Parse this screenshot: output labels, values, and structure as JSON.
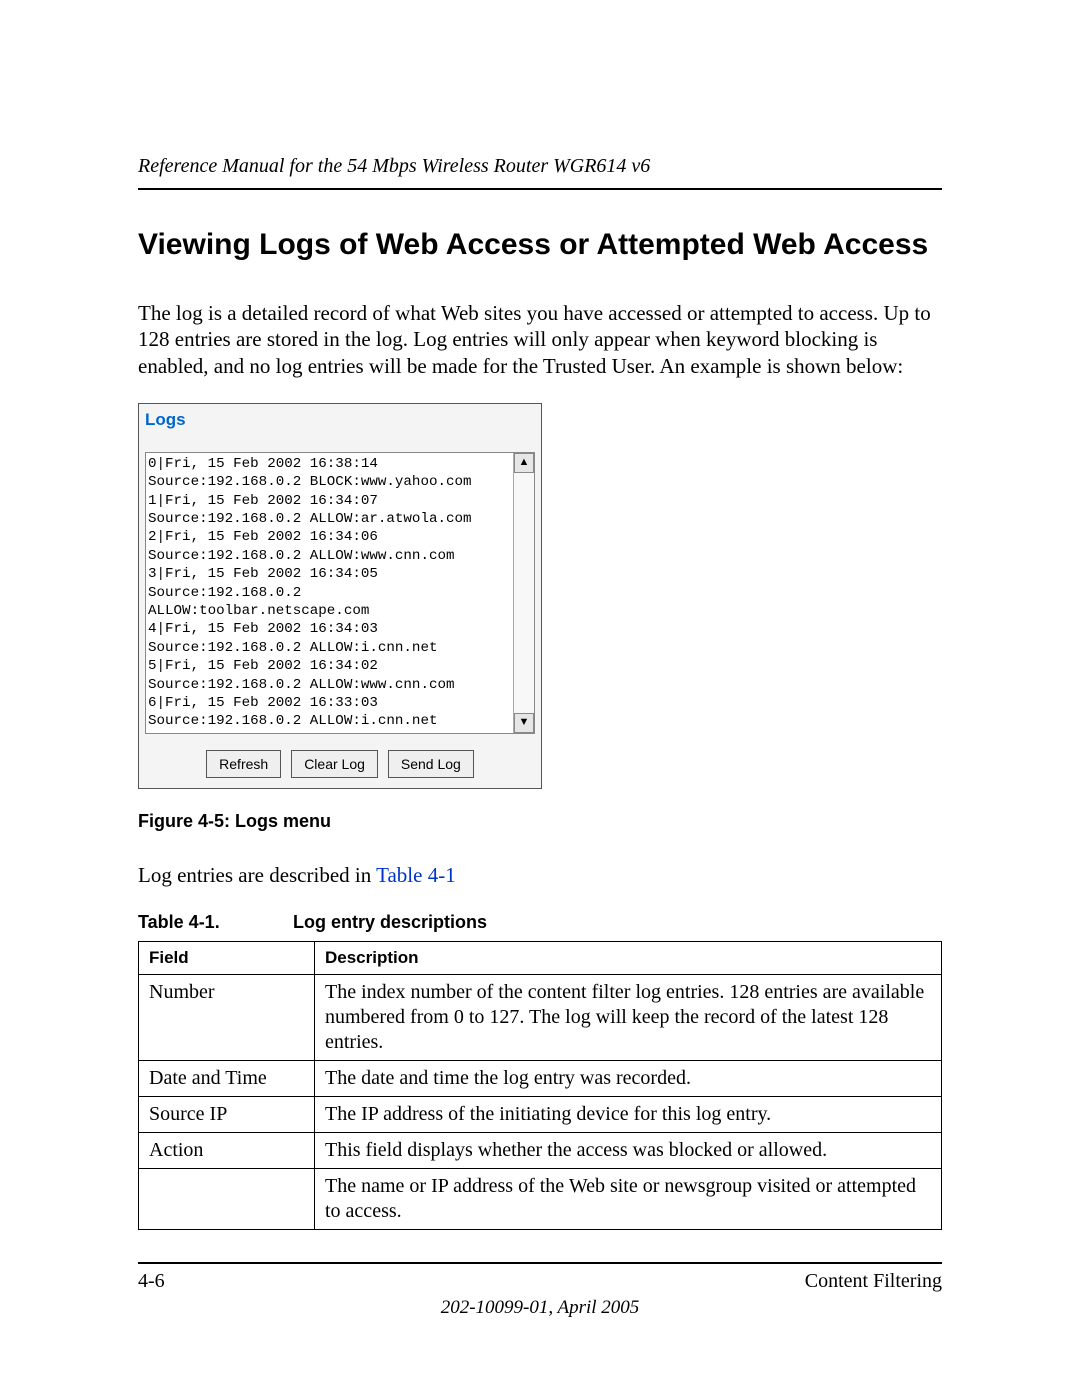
{
  "header": {
    "running_title": "Reference Manual for the 54 Mbps Wireless Router WGR614 v6"
  },
  "section": {
    "title": "Viewing Logs of Web Access or Attempted Web Access",
    "intro": "The log is a detailed record of what Web sites you have accessed or attempted to access. Up to 128 entries are stored in the log. Log entries will only appear when keyword blocking is enabled, and no log entries will be made for the Trusted User. An example is shown below:"
  },
  "logs_panel": {
    "title": "Logs",
    "content": "0|Fri, 15 Feb 2002 16:38:14\nSource:192.168.0.2 BLOCK:www.yahoo.com\n1|Fri, 15 Feb 2002 16:34:07\nSource:192.168.0.2 ALLOW:ar.atwola.com\n2|Fri, 15 Feb 2002 16:34:06\nSource:192.168.0.2 ALLOW:www.cnn.com\n3|Fri, 15 Feb 2002 16:34:05\nSource:192.168.0.2\nALLOW:toolbar.netscape.com\n4|Fri, 15 Feb 2002 16:34:03\nSource:192.168.0.2 ALLOW:i.cnn.net\n5|Fri, 15 Feb 2002 16:34:02\nSource:192.168.0.2 ALLOW:www.cnn.com\n6|Fri, 15 Feb 2002 16:33:03\nSource:192.168.0.2 ALLOW:i.cnn.net",
    "buttons": {
      "refresh": "Refresh",
      "clear": "Clear Log",
      "send": "Send Log"
    }
  },
  "figure_caption": "Figure 4-5:  Logs menu",
  "after_figure": {
    "prefix": "Log entries are described in ",
    "link": "Table 4-1"
  },
  "table": {
    "label": "Table 4-1.",
    "title": "Log entry descriptions",
    "headers": {
      "field": "Field",
      "description": "Description"
    },
    "rows": [
      {
        "field": "Number",
        "desc": "The index number of the content filter log entries. 128 entries are available numbered from 0 to 127. The log will keep the record of the latest 128 entries."
      },
      {
        "field": "Date and Time",
        "desc": "The date and time the log entry was recorded."
      },
      {
        "field": "Source IP",
        "desc": "The IP address of the initiating device for this log entry."
      },
      {
        "field": "Action",
        "desc": "This field displays whether the access was blocked or allowed."
      },
      {
        "field": "",
        "desc": "The name or IP address of the Web site or newsgroup visited or attempted to access."
      }
    ]
  },
  "footer": {
    "page_num": "4-6",
    "section_name": "Content Filtering",
    "doc_id": "202-10099-01, April 2005"
  }
}
